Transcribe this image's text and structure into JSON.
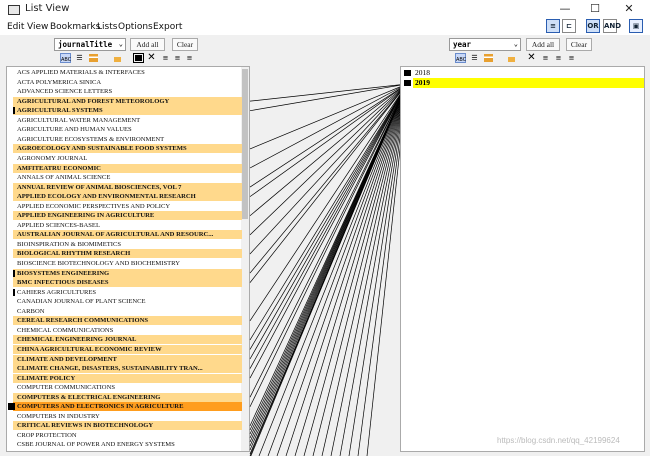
{
  "window": {
    "title": "List View",
    "minimize": "—",
    "maximize": "☐",
    "close": "✕"
  },
  "menu": [
    "Edit",
    "View",
    "Bookmarks",
    "Lists",
    "Options",
    "Export"
  ],
  "toolbar": {
    "or_label": "OR",
    "and_label": "AND"
  },
  "left_panel": {
    "field": "journalTitle",
    "add_all_label": "Add all",
    "clear_label": "Clear",
    "items": [
      {
        "label": "ACS APPLIED MATERIALS & INTERFACES",
        "selected": false,
        "marker": false
      },
      {
        "label": "ACTA POLYMERICA SINICA",
        "selected": false,
        "marker": false
      },
      {
        "label": "ADVANCED SCIENCE LETTERS",
        "selected": false,
        "marker": false
      },
      {
        "label": "AGRICULTURAL AND FOREST METEOROLOGY",
        "selected": true,
        "marker": false
      },
      {
        "label": "AGRICULTURAL SYSTEMS",
        "selected": true,
        "marker": true
      },
      {
        "label": "AGRICULTURAL WATER MANAGEMENT",
        "selected": false,
        "marker": false
      },
      {
        "label": "AGRICULTURE AND HUMAN VALUES",
        "selected": false,
        "marker": false
      },
      {
        "label": "AGRICULTURE ECOSYSTEMS & ENVIRONMENT",
        "selected": false,
        "marker": false
      },
      {
        "label": "AGROECOLOGY AND SUSTAINABLE FOOD SYSTEMS",
        "selected": true,
        "marker": false
      },
      {
        "label": "AGRONOMY JOURNAL",
        "selected": false,
        "marker": false
      },
      {
        "label": "AMFITEATRU ECONOMIC",
        "selected": true,
        "marker": false
      },
      {
        "label": "ANNALS OF ANIMAL SCIENCE",
        "selected": false,
        "marker": false
      },
      {
        "label": "ANNUAL REVIEW OF ANIMAL BIOSCIENCES, VOL 7",
        "selected": true,
        "marker": false
      },
      {
        "label": "APPLIED ECOLOGY AND ENVIRONMENTAL RESEARCH",
        "selected": true,
        "marker": false
      },
      {
        "label": "APPLIED ECONOMIC PERSPECTIVES AND POLICY",
        "selected": false,
        "marker": false
      },
      {
        "label": "APPLIED ENGINEERING IN AGRICULTURE",
        "selected": true,
        "marker": false
      },
      {
        "label": "APPLIED SCIENCES-BASEL",
        "selected": false,
        "marker": false
      },
      {
        "label": "AUSTRALIAN JOURNAL OF AGRICULTURAL AND RESOURC...",
        "selected": true,
        "marker": false
      },
      {
        "label": "BIOINSPIRATION & BIOMIMETICS",
        "selected": false,
        "marker": false
      },
      {
        "label": "BIOLOGICAL RHYTHM RESEARCH",
        "selected": true,
        "marker": false
      },
      {
        "label": "BIOSCIENCE BIOTECHNOLOGY AND BIOCHEMISTRY",
        "selected": false,
        "marker": false
      },
      {
        "label": "BIOSYSTEMS ENGINEERING",
        "selected": true,
        "marker": true
      },
      {
        "label": "BMC INFECTIOUS DISEASES",
        "selected": true,
        "marker": false
      },
      {
        "label": "CAHIERS AGRICULTURES",
        "selected": false,
        "marker": true
      },
      {
        "label": "CANADIAN JOURNAL OF PLANT SCIENCE",
        "selected": false,
        "marker": false
      },
      {
        "label": "CARBON",
        "selected": false,
        "marker": false
      },
      {
        "label": "CEREAL RESEARCH COMMUNICATIONS",
        "selected": true,
        "marker": false
      },
      {
        "label": "CHEMICAL COMMUNICATIONS",
        "selected": false,
        "marker": false
      },
      {
        "label": "CHEMICAL ENGINEERING JOURNAL",
        "selected": true,
        "marker": false
      },
      {
        "label": "CHINA AGRICULTURAL ECONOMIC REVIEW",
        "selected": true,
        "marker": false
      },
      {
        "label": "CLIMATE AND DEVELOPMENT",
        "selected": true,
        "marker": false
      },
      {
        "label": "CLIMATE CHANGE, DISASTERS, SUSTAINABILITY TRAN...",
        "selected": true,
        "marker": false
      },
      {
        "label": "CLIMATE POLICY",
        "selected": true,
        "marker": false
      },
      {
        "label": "COMPUTER COMMUNICATIONS",
        "selected": false,
        "marker": false
      },
      {
        "label": "COMPUTERS & ELECTRICAL ENGINEERING",
        "selected": true,
        "marker": false
      },
      {
        "label": "COMPUTERS AND ELECTRONICS IN AGRICULTURE",
        "selected": true,
        "marker": true,
        "current": true
      },
      {
        "label": "COMPUTERS IN INDUSTRY",
        "selected": false,
        "marker": false
      },
      {
        "label": "CRITICAL REVIEWS IN BIOTECHNOLOGY",
        "selected": true,
        "marker": false
      },
      {
        "label": "CROP PROTECTION",
        "selected": false,
        "marker": false
      },
      {
        "label": "CSBE JOURNAL OF POWER AND ENERGY SYSTEMS",
        "selected": false,
        "marker": false
      }
    ]
  },
  "right_panel": {
    "field": "year",
    "add_all_label": "Add all",
    "clear_label": "Clear",
    "items": [
      {
        "label": "2018",
        "selected": false
      },
      {
        "label": "2019",
        "selected": true
      }
    ]
  },
  "colors": {
    "selected_row": "#ffd98c",
    "current_row": "#ff9d1e",
    "selected_year": "#ffff00"
  },
  "watermark": "https://blog.csdn.net/qq_42199624"
}
